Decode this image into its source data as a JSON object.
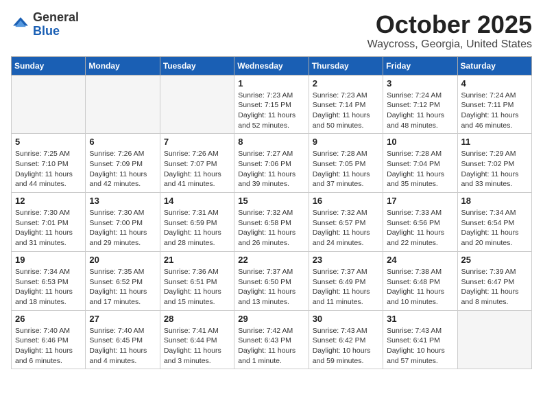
{
  "header": {
    "logo": {
      "line1": "General",
      "line2": "Blue"
    },
    "month_title": "October 2025",
    "location": "Waycross, Georgia, United States"
  },
  "weekdays": [
    "Sunday",
    "Monday",
    "Tuesday",
    "Wednesday",
    "Thursday",
    "Friday",
    "Saturday"
  ],
  "weeks": [
    [
      {
        "day": "",
        "sunrise": "",
        "sunset": "",
        "daylight": ""
      },
      {
        "day": "",
        "sunrise": "",
        "sunset": "",
        "daylight": ""
      },
      {
        "day": "",
        "sunrise": "",
        "sunset": "",
        "daylight": ""
      },
      {
        "day": "1",
        "sunrise": "Sunrise: 7:23 AM",
        "sunset": "Sunset: 7:15 PM",
        "daylight": "Daylight: 11 hours and 52 minutes."
      },
      {
        "day": "2",
        "sunrise": "Sunrise: 7:23 AM",
        "sunset": "Sunset: 7:14 PM",
        "daylight": "Daylight: 11 hours and 50 minutes."
      },
      {
        "day": "3",
        "sunrise": "Sunrise: 7:24 AM",
        "sunset": "Sunset: 7:12 PM",
        "daylight": "Daylight: 11 hours and 48 minutes."
      },
      {
        "day": "4",
        "sunrise": "Sunrise: 7:24 AM",
        "sunset": "Sunset: 7:11 PM",
        "daylight": "Daylight: 11 hours and 46 minutes."
      }
    ],
    [
      {
        "day": "5",
        "sunrise": "Sunrise: 7:25 AM",
        "sunset": "Sunset: 7:10 PM",
        "daylight": "Daylight: 11 hours and 44 minutes."
      },
      {
        "day": "6",
        "sunrise": "Sunrise: 7:26 AM",
        "sunset": "Sunset: 7:09 PM",
        "daylight": "Daylight: 11 hours and 42 minutes."
      },
      {
        "day": "7",
        "sunrise": "Sunrise: 7:26 AM",
        "sunset": "Sunset: 7:07 PM",
        "daylight": "Daylight: 11 hours and 41 minutes."
      },
      {
        "day": "8",
        "sunrise": "Sunrise: 7:27 AM",
        "sunset": "Sunset: 7:06 PM",
        "daylight": "Daylight: 11 hours and 39 minutes."
      },
      {
        "day": "9",
        "sunrise": "Sunrise: 7:28 AM",
        "sunset": "Sunset: 7:05 PM",
        "daylight": "Daylight: 11 hours and 37 minutes."
      },
      {
        "day": "10",
        "sunrise": "Sunrise: 7:28 AM",
        "sunset": "Sunset: 7:04 PM",
        "daylight": "Daylight: 11 hours and 35 minutes."
      },
      {
        "day": "11",
        "sunrise": "Sunrise: 7:29 AM",
        "sunset": "Sunset: 7:02 PM",
        "daylight": "Daylight: 11 hours and 33 minutes."
      }
    ],
    [
      {
        "day": "12",
        "sunrise": "Sunrise: 7:30 AM",
        "sunset": "Sunset: 7:01 PM",
        "daylight": "Daylight: 11 hours and 31 minutes."
      },
      {
        "day": "13",
        "sunrise": "Sunrise: 7:30 AM",
        "sunset": "Sunset: 7:00 PM",
        "daylight": "Daylight: 11 hours and 29 minutes."
      },
      {
        "day": "14",
        "sunrise": "Sunrise: 7:31 AM",
        "sunset": "Sunset: 6:59 PM",
        "daylight": "Daylight: 11 hours and 28 minutes."
      },
      {
        "day": "15",
        "sunrise": "Sunrise: 7:32 AM",
        "sunset": "Sunset: 6:58 PM",
        "daylight": "Daylight: 11 hours and 26 minutes."
      },
      {
        "day": "16",
        "sunrise": "Sunrise: 7:32 AM",
        "sunset": "Sunset: 6:57 PM",
        "daylight": "Daylight: 11 hours and 24 minutes."
      },
      {
        "day": "17",
        "sunrise": "Sunrise: 7:33 AM",
        "sunset": "Sunset: 6:56 PM",
        "daylight": "Daylight: 11 hours and 22 minutes."
      },
      {
        "day": "18",
        "sunrise": "Sunrise: 7:34 AM",
        "sunset": "Sunset: 6:54 PM",
        "daylight": "Daylight: 11 hours and 20 minutes."
      }
    ],
    [
      {
        "day": "19",
        "sunrise": "Sunrise: 7:34 AM",
        "sunset": "Sunset: 6:53 PM",
        "daylight": "Daylight: 11 hours and 18 minutes."
      },
      {
        "day": "20",
        "sunrise": "Sunrise: 7:35 AM",
        "sunset": "Sunset: 6:52 PM",
        "daylight": "Daylight: 11 hours and 17 minutes."
      },
      {
        "day": "21",
        "sunrise": "Sunrise: 7:36 AM",
        "sunset": "Sunset: 6:51 PM",
        "daylight": "Daylight: 11 hours and 15 minutes."
      },
      {
        "day": "22",
        "sunrise": "Sunrise: 7:37 AM",
        "sunset": "Sunset: 6:50 PM",
        "daylight": "Daylight: 11 hours and 13 minutes."
      },
      {
        "day": "23",
        "sunrise": "Sunrise: 7:37 AM",
        "sunset": "Sunset: 6:49 PM",
        "daylight": "Daylight: 11 hours and 11 minutes."
      },
      {
        "day": "24",
        "sunrise": "Sunrise: 7:38 AM",
        "sunset": "Sunset: 6:48 PM",
        "daylight": "Daylight: 11 hours and 10 minutes."
      },
      {
        "day": "25",
        "sunrise": "Sunrise: 7:39 AM",
        "sunset": "Sunset: 6:47 PM",
        "daylight": "Daylight: 11 hours and 8 minutes."
      }
    ],
    [
      {
        "day": "26",
        "sunrise": "Sunrise: 7:40 AM",
        "sunset": "Sunset: 6:46 PM",
        "daylight": "Daylight: 11 hours and 6 minutes."
      },
      {
        "day": "27",
        "sunrise": "Sunrise: 7:40 AM",
        "sunset": "Sunset: 6:45 PM",
        "daylight": "Daylight: 11 hours and 4 minutes."
      },
      {
        "day": "28",
        "sunrise": "Sunrise: 7:41 AM",
        "sunset": "Sunset: 6:44 PM",
        "daylight": "Daylight: 11 hours and 3 minutes."
      },
      {
        "day": "29",
        "sunrise": "Sunrise: 7:42 AM",
        "sunset": "Sunset: 6:43 PM",
        "daylight": "Daylight: 11 hours and 1 minute."
      },
      {
        "day": "30",
        "sunrise": "Sunrise: 7:43 AM",
        "sunset": "Sunset: 6:42 PM",
        "daylight": "Daylight: 10 hours and 59 minutes."
      },
      {
        "day": "31",
        "sunrise": "Sunrise: 7:43 AM",
        "sunset": "Sunset: 6:41 PM",
        "daylight": "Daylight: 10 hours and 57 minutes."
      },
      {
        "day": "",
        "sunrise": "",
        "sunset": "",
        "daylight": ""
      }
    ]
  ]
}
